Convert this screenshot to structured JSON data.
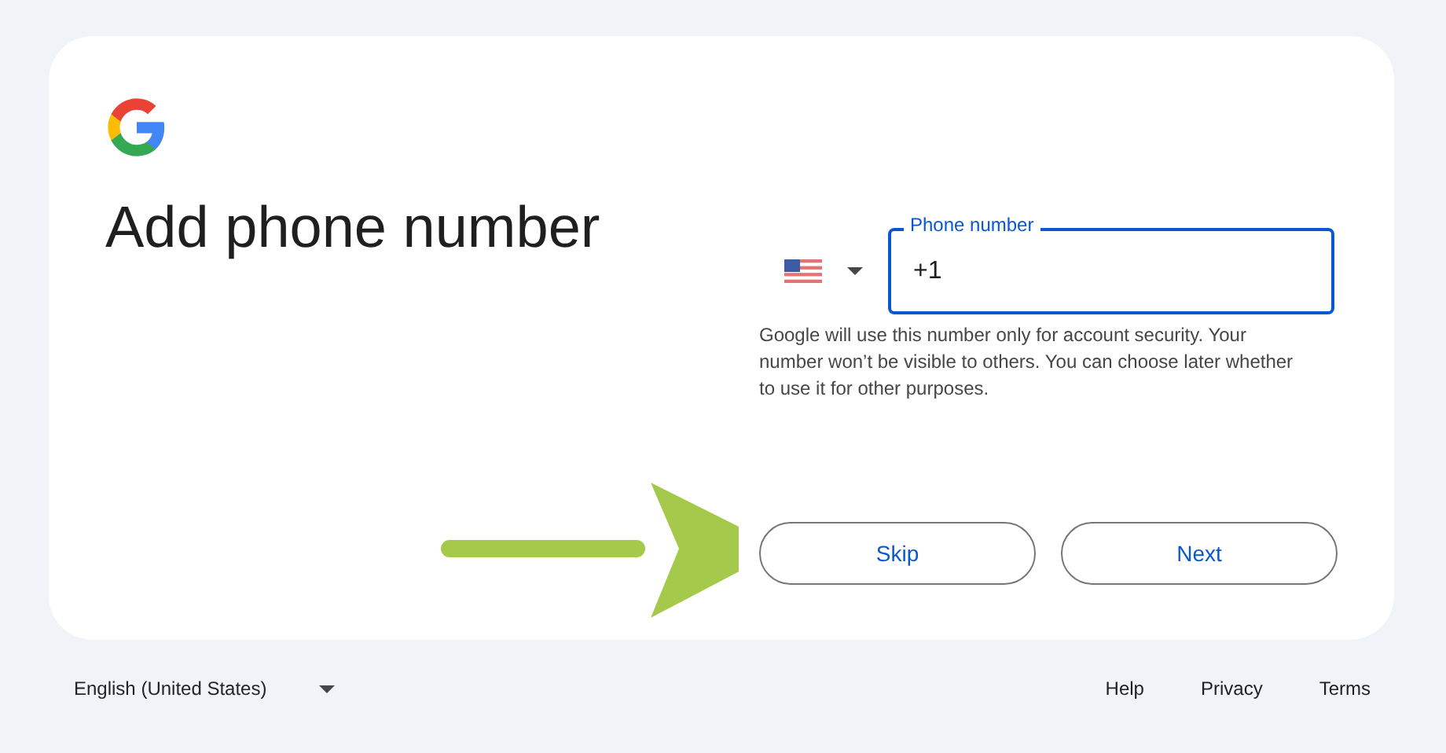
{
  "card": {
    "title": "Add phone number",
    "phone_field": {
      "label": "Phone number",
      "value": "+1",
      "focused": true
    },
    "help_text": "Google will use this number only for account security. Your number won’t be visible to others. You can choose later whether to use it for other purposes.",
    "buttons": [
      {
        "label": "Skip"
      },
      {
        "label": "Next"
      }
    ]
  },
  "footer": {
    "language": "English (United States)",
    "links": [
      "Help",
      "Privacy",
      "Terms"
    ]
  }
}
